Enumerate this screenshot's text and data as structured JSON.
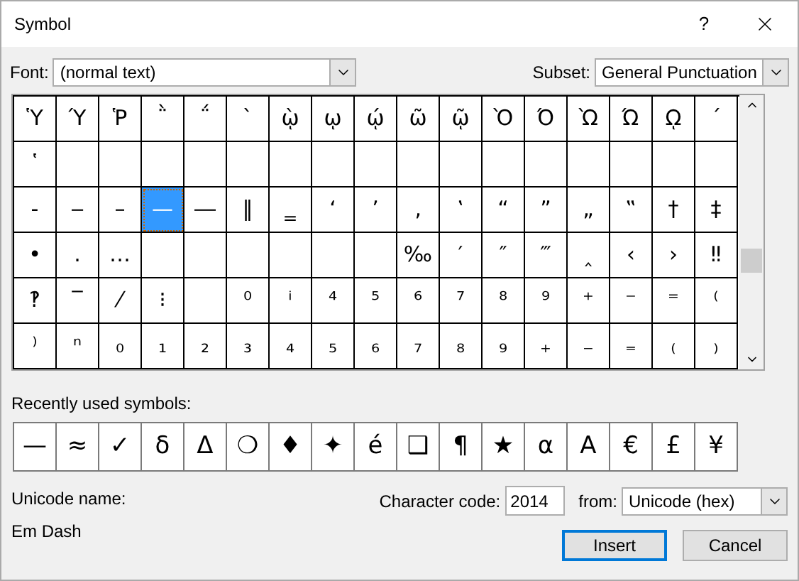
{
  "window": {
    "title": "Symbol",
    "help": "?"
  },
  "font": {
    "label": "Font:",
    "value": "(normal text)"
  },
  "subset": {
    "label": "Subset:",
    "value": "General Punctuation"
  },
  "grid": [
    [
      {
        "c": "Ὑ",
        "selected": false
      },
      {
        "c": "Ύ",
        "selected": false
      },
      {
        "c": "Ῥ",
        "selected": false
      },
      {
        "c": "῭",
        "selected": false
      },
      {
        "c": "΅",
        "selected": false
      },
      {
        "c": "`",
        "selected": false
      },
      {
        "c": "ῲ",
        "selected": false
      },
      {
        "c": "ῳ",
        "selected": false
      },
      {
        "c": "ῴ",
        "selected": false
      },
      {
        "c": "ῶ",
        "selected": false
      },
      {
        "c": "ῷ",
        "selected": false
      },
      {
        "c": "Ὸ",
        "selected": false
      },
      {
        "c": "Ό",
        "selected": false
      },
      {
        "c": "Ὼ",
        "selected": false
      },
      {
        "c": "Ώ",
        "selected": false
      },
      {
        "c": "ῼ",
        "selected": false
      },
      {
        "c": "´",
        "selected": false
      }
    ],
    [
      {
        "c": "῾",
        "selected": false
      },
      {
        "selected": false
      },
      {
        "selected": false
      },
      {
        "selected": false
      },
      {
        "selected": false
      },
      {
        "selected": false
      },
      {
        "selected": false
      },
      {
        "selected": false
      },
      {
        "selected": false
      },
      {
        "selected": false
      },
      {
        "selected": false
      },
      {
        "selected": false
      },
      {
        "selected": false
      },
      {
        "selected": false
      },
      {
        "selected": false
      },
      {
        "selected": false
      },
      {
        "selected": false
      }
    ],
    [
      {
        "c": "‐",
        "selected": false
      },
      {
        "c": "‒",
        "selected": false
      },
      {
        "c": "–",
        "selected": false
      },
      {
        "c": "—",
        "selected": true
      },
      {
        "c": "―",
        "selected": false
      },
      {
        "c": "‖",
        "selected": false
      },
      {
        "c": "‗",
        "selected": false
      },
      {
        "c": "‘",
        "selected": false
      },
      {
        "c": "’",
        "selected": false
      },
      {
        "c": "‚",
        "selected": false
      },
      {
        "c": "‛",
        "selected": false
      },
      {
        "c": "“",
        "selected": false
      },
      {
        "c": "”",
        "selected": false
      },
      {
        "c": "„",
        "selected": false
      },
      {
        "c": "‟",
        "selected": false
      },
      {
        "c": "†",
        "selected": false
      },
      {
        "c": "‡",
        "selected": false
      }
    ],
    [
      {
        "c": "•",
        "selected": false
      },
      {
        "c": "․",
        "selected": false
      },
      {
        "c": "…",
        "selected": false
      },
      {
        "selected": false
      },
      {
        "selected": false
      },
      {
        "selected": false
      },
      {
        "selected": false
      },
      {
        "selected": false
      },
      {
        "selected": false
      },
      {
        "c": "‰",
        "selected": false
      },
      {
        "c": "′",
        "selected": false
      },
      {
        "c": "″",
        "selected": false
      },
      {
        "c": "‴",
        "selected": false
      },
      {
        "c": "‸",
        "selected": false
      },
      {
        "c": "‹",
        "selected": false
      },
      {
        "c": "›",
        "selected": false
      },
      {
        "c": "‼",
        "selected": false
      }
    ],
    [
      {
        "c": "‽",
        "selected": false
      },
      {
        "c": "‾",
        "selected": false
      },
      {
        "c": "⁄",
        "selected": false
      },
      {
        "c": "⁝",
        "selected": false
      },
      {
        "selected": false
      },
      {
        "c": "⁰",
        "selected": false
      },
      {
        "c": "ⁱ",
        "selected": false
      },
      {
        "c": "⁴",
        "selected": false
      },
      {
        "c": "⁵",
        "selected": false
      },
      {
        "c": "⁶",
        "selected": false
      },
      {
        "c": "⁷",
        "selected": false
      },
      {
        "c": "⁸",
        "selected": false
      },
      {
        "c": "⁹",
        "selected": false
      },
      {
        "c": "⁺",
        "selected": false
      },
      {
        "c": "⁻",
        "selected": false
      },
      {
        "c": "⁼",
        "selected": false
      },
      {
        "c": "⁽",
        "selected": false
      }
    ],
    [
      {
        "c": "⁾",
        "selected": false
      },
      {
        "c": "ⁿ",
        "selected": false
      },
      {
        "c": "₀",
        "selected": false
      },
      {
        "c": "₁",
        "selected": false
      },
      {
        "c": "₂",
        "selected": false
      },
      {
        "c": "₃",
        "selected": false
      },
      {
        "c": "₄",
        "selected": false
      },
      {
        "c": "₅",
        "selected": false
      },
      {
        "c": "₆",
        "selected": false
      },
      {
        "c": "₇",
        "selected": false
      },
      {
        "c": "₈",
        "selected": false
      },
      {
        "c": "₉",
        "selected": false
      },
      {
        "c": "₊",
        "selected": false
      },
      {
        "c": "₋",
        "selected": false
      },
      {
        "c": "₌",
        "selected": false
      },
      {
        "c": "₍",
        "selected": false
      },
      {
        "c": "₎",
        "selected": false
      }
    ]
  ],
  "recent": {
    "label": "Recently used symbols:",
    "symbols": [
      "—",
      "≈",
      "✓",
      "δ",
      "Δ",
      "❍",
      "♦",
      "✦",
      "é",
      "❑",
      "¶",
      "★",
      "α",
      "A",
      "€",
      "£",
      "¥"
    ]
  },
  "unicode_name": {
    "label": "Unicode name:",
    "value": "Em Dash"
  },
  "character_code": {
    "label": "Character code:",
    "value": "2014"
  },
  "from": {
    "label": "from:",
    "value": "Unicode (hex)"
  },
  "buttons": [
    {
      "label": "Insert",
      "default": true
    },
    {
      "label": "Cancel",
      "default": false
    }
  ]
}
